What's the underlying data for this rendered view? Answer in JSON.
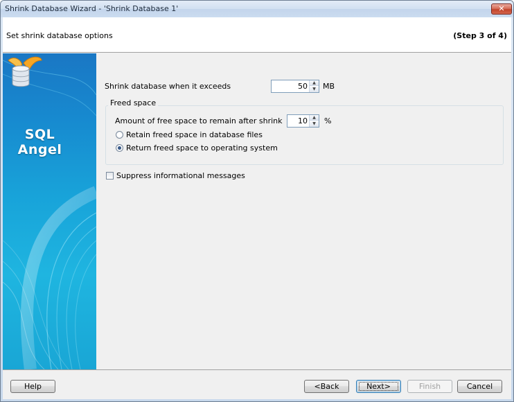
{
  "window": {
    "title": "Shrink Database Wizard - 'Shrink Database 1'",
    "close_glyph": "✕"
  },
  "header": {
    "title": "Set shrink database options",
    "step": "(Step 3 of 4)"
  },
  "banner": {
    "logo_line1": "SQL",
    "logo_line2": "Angel",
    "icon": "sql-angel-logo-icon"
  },
  "options": {
    "shrink_label": "Shrink database when it exceeds",
    "shrink_value": "50",
    "shrink_unit": "MB",
    "freed_space": {
      "caption": "Freed space",
      "amount_label": "Amount of free space to remain after shrink",
      "amount_value": "10",
      "amount_unit": "%",
      "radio_retain": "Retain freed space in database files",
      "radio_return": "Return freed space to operating system",
      "selected": "return"
    },
    "suppress_label": "Suppress informational messages",
    "suppress_checked": false
  },
  "footer": {
    "help": "Help",
    "back": "<Back",
    "next": "Next>",
    "finish": "Finish",
    "cancel": "Cancel"
  },
  "colors": {
    "banner_blue": "#1789cf",
    "banner_light": "#1fb5e0",
    "close_red": "#c2442b"
  }
}
